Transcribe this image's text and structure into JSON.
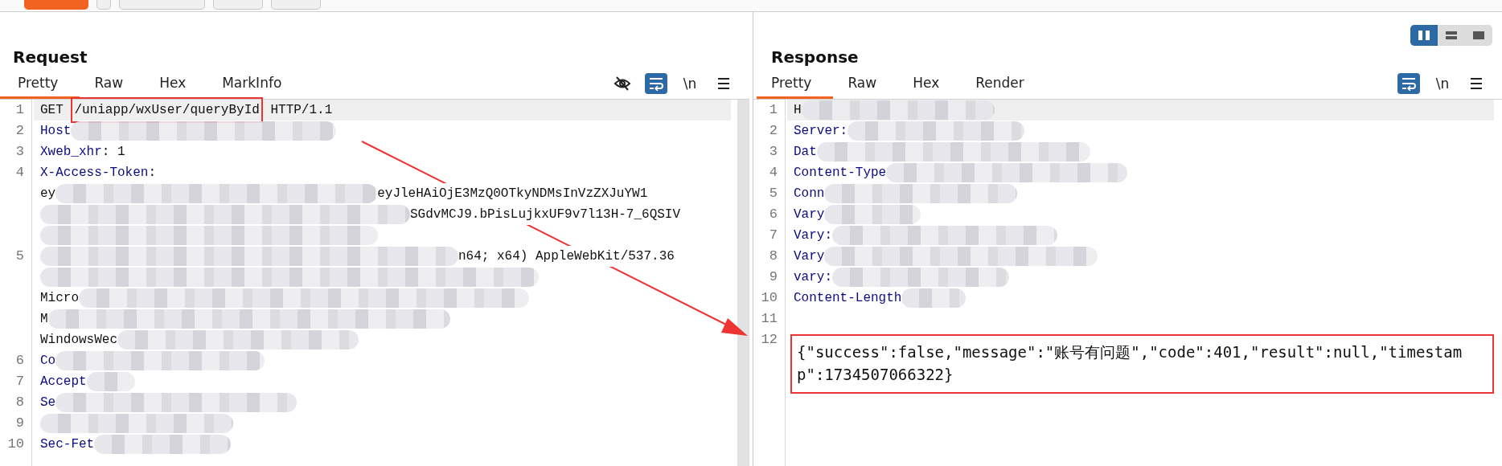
{
  "view_toggle": [
    {
      "kind": "columns",
      "selected": true
    },
    {
      "kind": "rows",
      "selected": false
    },
    {
      "kind": "single",
      "selected": false
    }
  ],
  "request": {
    "title": "Request",
    "tabs": [
      {
        "label": "Pretty",
        "selected": true
      },
      {
        "label": "Raw",
        "selected": false
      },
      {
        "label": "Hex",
        "selected": false
      },
      {
        "label": "MarkInfo",
        "selected": false
      }
    ],
    "tools": [
      {
        "kind": "hide",
        "on": false
      },
      {
        "kind": "wrap",
        "on": true
      },
      {
        "kind": "newline",
        "text": "\\n",
        "on": false
      },
      {
        "kind": "menu",
        "on": false
      }
    ],
    "lines": [
      {
        "num": "1",
        "current": true,
        "segments": [
          {
            "kind": "plain",
            "text": "GET "
          },
          {
            "kind": "plain",
            "text": "/uniapp/wxUser/queryById",
            "highlighted": true
          },
          {
            "kind": "plain",
            "text": " HTTP/1.1"
          }
        ]
      },
      {
        "num": "2",
        "segments": [
          {
            "kind": "key",
            "text": "Host"
          },
          {
            "kind": "redacted"
          }
        ]
      },
      {
        "num": "3",
        "segments": [
          {
            "kind": "key",
            "text": "Xweb_xhr"
          },
          {
            "kind": "plain",
            "text": ": 1"
          }
        ]
      },
      {
        "num": "4",
        "segments": [
          {
            "kind": "key",
            "text": "X-Access-Token"
          },
          {
            "kind": "plain",
            "text": ":"
          }
        ]
      },
      {
        "segments": [
          {
            "kind": "plain",
            "text": "ey"
          },
          {
            "kind": "redacted"
          },
          {
            "kind": "plain",
            "text": "eyJleHAiOjE3MzQ0OTkyNDMsInVzZXJuYW1"
          }
        ]
      },
      {
        "segments": [
          {
            "kind": "redacted"
          },
          {
            "kind": "plain",
            "text": "SGdvMCJ9.bPisLujkxUF9v7l13H-7_6QSIV"
          }
        ]
      },
      {
        "segments": [
          {
            "kind": "redacted"
          }
        ]
      },
      {
        "num": "5",
        "segments": [
          {
            "kind": "redacted"
          },
          {
            "kind": "plain",
            "text": "n64; x64) AppleWebKit/537.36"
          }
        ]
      },
      {
        "segments": [
          {
            "kind": "redacted"
          }
        ]
      },
      {
        "segments": [
          {
            "kind": "plain",
            "text": "Micro"
          },
          {
            "kind": "redacted"
          }
        ]
      },
      {
        "segments": [
          {
            "kind": "plain",
            "text": "M"
          },
          {
            "kind": "redacted"
          }
        ]
      },
      {
        "segments": [
          {
            "kind": "plain",
            "text": "WindowsWec"
          },
          {
            "kind": "redacted"
          }
        ]
      },
      {
        "num": "6",
        "segments": [
          {
            "kind": "key",
            "text": "Co"
          },
          {
            "kind": "redacted"
          }
        ]
      },
      {
        "num": "7",
        "segments": [
          {
            "kind": "key",
            "text": "Accept"
          },
          {
            "kind": "redacted"
          }
        ]
      },
      {
        "num": "8",
        "segments": [
          {
            "kind": "key",
            "text": "Se"
          },
          {
            "kind": "redacted"
          }
        ]
      },
      {
        "num": "9",
        "segments": [
          {
            "kind": "redacted"
          }
        ]
      },
      {
        "num": "10",
        "segments": [
          {
            "kind": "key",
            "text": "Sec-Fet"
          },
          {
            "kind": "redacted"
          }
        ]
      }
    ]
  },
  "response": {
    "title": "Response",
    "tabs": [
      {
        "label": "Pretty",
        "selected": true
      },
      {
        "label": "Raw",
        "selected": false
      },
      {
        "label": "Hex",
        "selected": false
      },
      {
        "label": "Render",
        "selected": false
      }
    ],
    "tools": [
      {
        "kind": "wrap",
        "on": true
      },
      {
        "kind": "newline",
        "text": "\\n",
        "on": false
      },
      {
        "kind": "menu",
        "on": false
      }
    ],
    "lines": [
      {
        "num": "1",
        "current": true,
        "segments": [
          {
            "kind": "plain",
            "text": "H"
          },
          {
            "kind": "redacted"
          }
        ]
      },
      {
        "num": "2",
        "segments": [
          {
            "kind": "key",
            "text": "Server:"
          },
          {
            "kind": "redacted"
          }
        ]
      },
      {
        "num": "3",
        "segments": [
          {
            "kind": "key",
            "text": "Dat"
          },
          {
            "kind": "redacted"
          }
        ]
      },
      {
        "num": "4",
        "segments": [
          {
            "kind": "key",
            "text": "Content-Type"
          },
          {
            "kind": "redacted"
          }
        ]
      },
      {
        "num": "5",
        "segments": [
          {
            "kind": "key",
            "text": "Conn"
          },
          {
            "kind": "redacted"
          }
        ]
      },
      {
        "num": "6",
        "segments": [
          {
            "kind": "key",
            "text": "Vary"
          },
          {
            "kind": "redacted"
          }
        ]
      },
      {
        "num": "7",
        "segments": [
          {
            "kind": "key",
            "text": "Vary:"
          },
          {
            "kind": "redacted"
          }
        ]
      },
      {
        "num": "8",
        "segments": [
          {
            "kind": "key",
            "text": "Vary"
          },
          {
            "kind": "redacted"
          }
        ]
      },
      {
        "num": "9",
        "segments": [
          {
            "kind": "key",
            "text": "vary:"
          },
          {
            "kind": "redacted"
          }
        ]
      },
      {
        "num": "10",
        "segments": [
          {
            "kind": "key",
            "text": "Content-Length"
          },
          {
            "kind": "redacted"
          }
        ]
      },
      {
        "num": "11"
      },
      {
        "num": "12",
        "segments": [
          {
            "kind": "body",
            "text": "{\"success\":false,\"message\":\"账号有问题\",\"code\":401,\"result\":null,\"timestamp\":1734507066322}",
            "highlighted": true
          }
        ]
      }
    ]
  },
  "annotation_arrow": true
}
